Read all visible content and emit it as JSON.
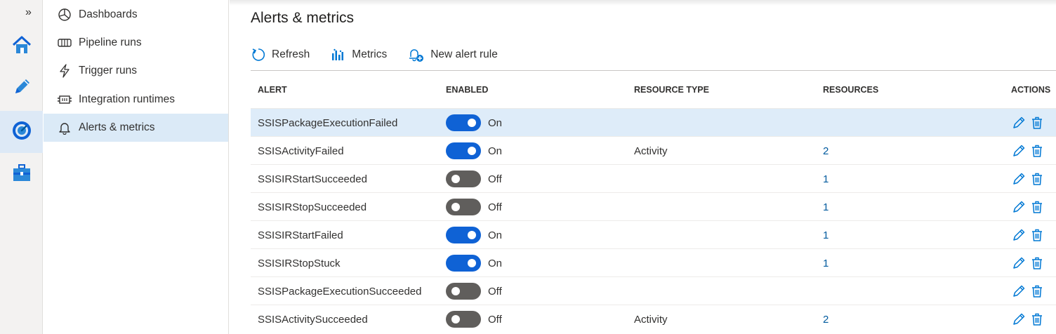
{
  "rail": {
    "expand_glyph": "»",
    "items": [
      {
        "icon": "home-icon"
      },
      {
        "icon": "pencil-author-icon"
      },
      {
        "icon": "monitor-gauge-icon",
        "selected": true
      },
      {
        "icon": "toolbox-manage-icon"
      }
    ]
  },
  "subnav": {
    "items": [
      {
        "label": "Dashboards",
        "icon": "dashboard-icon"
      },
      {
        "label": "Pipeline runs",
        "icon": "pipeline-icon"
      },
      {
        "label": "Trigger runs",
        "icon": "lightning-icon"
      },
      {
        "label": "Integration runtimes",
        "icon": "runtime-icon"
      },
      {
        "label": "Alerts & metrics",
        "icon": "bell-icon",
        "selected": true
      }
    ]
  },
  "page": {
    "title": "Alerts & metrics"
  },
  "toolbar": {
    "refresh_label": "Refresh",
    "metrics_label": "Metrics",
    "new_alert_label": "New alert rule"
  },
  "table": {
    "headers": {
      "alert": "ALERT",
      "enabled": "ENABLED",
      "resource_type": "RESOURCE TYPE",
      "resources": "RESOURCES",
      "actions": "ACTIONS"
    },
    "rows": [
      {
        "alert": "SSISPackageExecutionFailed",
        "enabled": true,
        "status": "On",
        "resource_type": "",
        "resources": "",
        "selected": true
      },
      {
        "alert": "SSISActivityFailed",
        "enabled": true,
        "status": "On",
        "resource_type": "Activity",
        "resources": "2"
      },
      {
        "alert": "SSISIRStartSucceeded",
        "enabled": false,
        "status": "Off",
        "resource_type": "",
        "resources": "1"
      },
      {
        "alert": "SSISIRStopSucceeded",
        "enabled": false,
        "status": "Off",
        "resource_type": "",
        "resources": "1"
      },
      {
        "alert": "SSISIRStartFailed",
        "enabled": true,
        "status": "On",
        "resource_type": "",
        "resources": "1"
      },
      {
        "alert": "SSISIRStopStuck",
        "enabled": true,
        "status": "On",
        "resource_type": "",
        "resources": "1"
      },
      {
        "alert": "SSISPackageExecutionSucceeded",
        "enabled": false,
        "status": "Off",
        "resource_type": "",
        "resources": ""
      },
      {
        "alert": "SSISActivitySucceeded",
        "enabled": false,
        "status": "Off",
        "resource_type": "Activity",
        "resources": "2"
      }
    ]
  },
  "colors": {
    "accent": "#0078d4",
    "toggle_on": "#0f62d5",
    "toggle_off": "#605e5c",
    "selected_row": "#deecf9",
    "link": "#005a9e"
  }
}
